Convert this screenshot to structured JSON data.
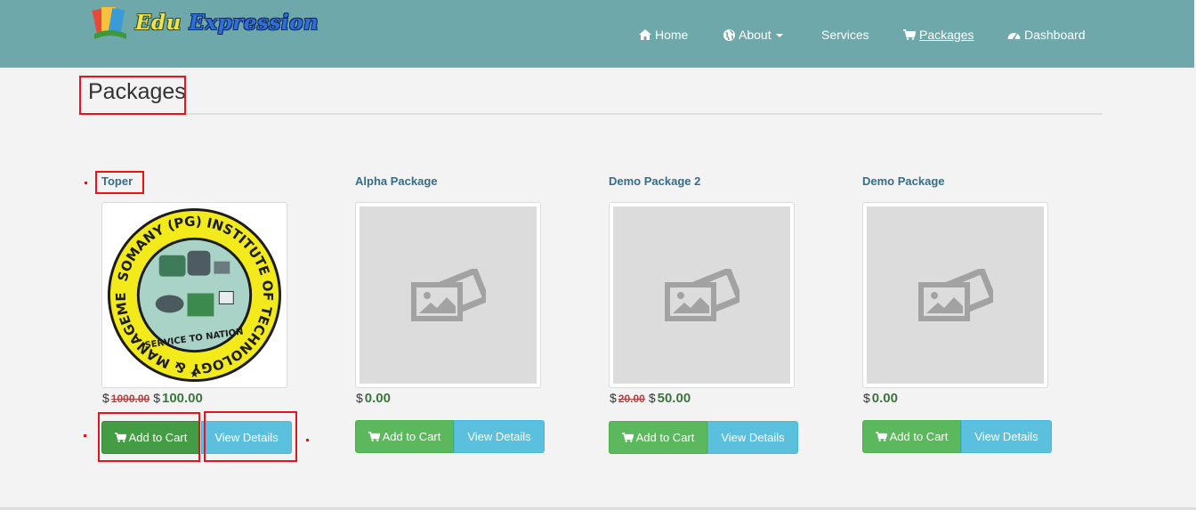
{
  "navbar": {
    "brand": {
      "word1": "Edu",
      "word2": "Expression"
    },
    "items": [
      {
        "label": "Home",
        "icon": "home-icon"
      },
      {
        "label": "About",
        "icon": "globe-icon"
      },
      {
        "label": "Services"
      },
      {
        "label": "Packages",
        "icon": "cart-icon",
        "active": true
      },
      {
        "label": "Dashboard",
        "icon": "dashboard-icon"
      }
    ]
  },
  "page": {
    "title": "Packages"
  },
  "packages": [
    {
      "name": "Toper",
      "currency": "$",
      "old_price": "1000.00",
      "price": "100.00",
      "cart_label": "Add to Cart",
      "view_label": "View Details",
      "image": "institute-seal"
    },
    {
      "name": "Alpha Package",
      "currency": "$",
      "old_price": "",
      "price": "0.00",
      "cart_label": "Add to Cart",
      "view_label": "View Details",
      "image": "image-placeholder-icon"
    },
    {
      "name": "Demo Package 2",
      "currency": "$",
      "old_price": "20.00",
      "price": "50.00",
      "cart_label": "Add to Cart",
      "view_label": "View Details",
      "image": "image-placeholder-icon"
    },
    {
      "name": "Demo Package",
      "currency": "$",
      "old_price": "",
      "price": "0.00",
      "cart_label": "Add to Cart",
      "view_label": "View Details",
      "image": "image-placeholder-icon"
    }
  ],
  "seal": {
    "ring_text": "SOMANY (PG) INSTITUTE OF TECHNOLOGY & MANAGEMENT",
    "motto": "SERVICE TO NATION"
  },
  "colors": {
    "navbar": "#6fa8aa",
    "success": "#5cb85c",
    "info": "#5bc0de",
    "annotation": "#e8141a"
  }
}
